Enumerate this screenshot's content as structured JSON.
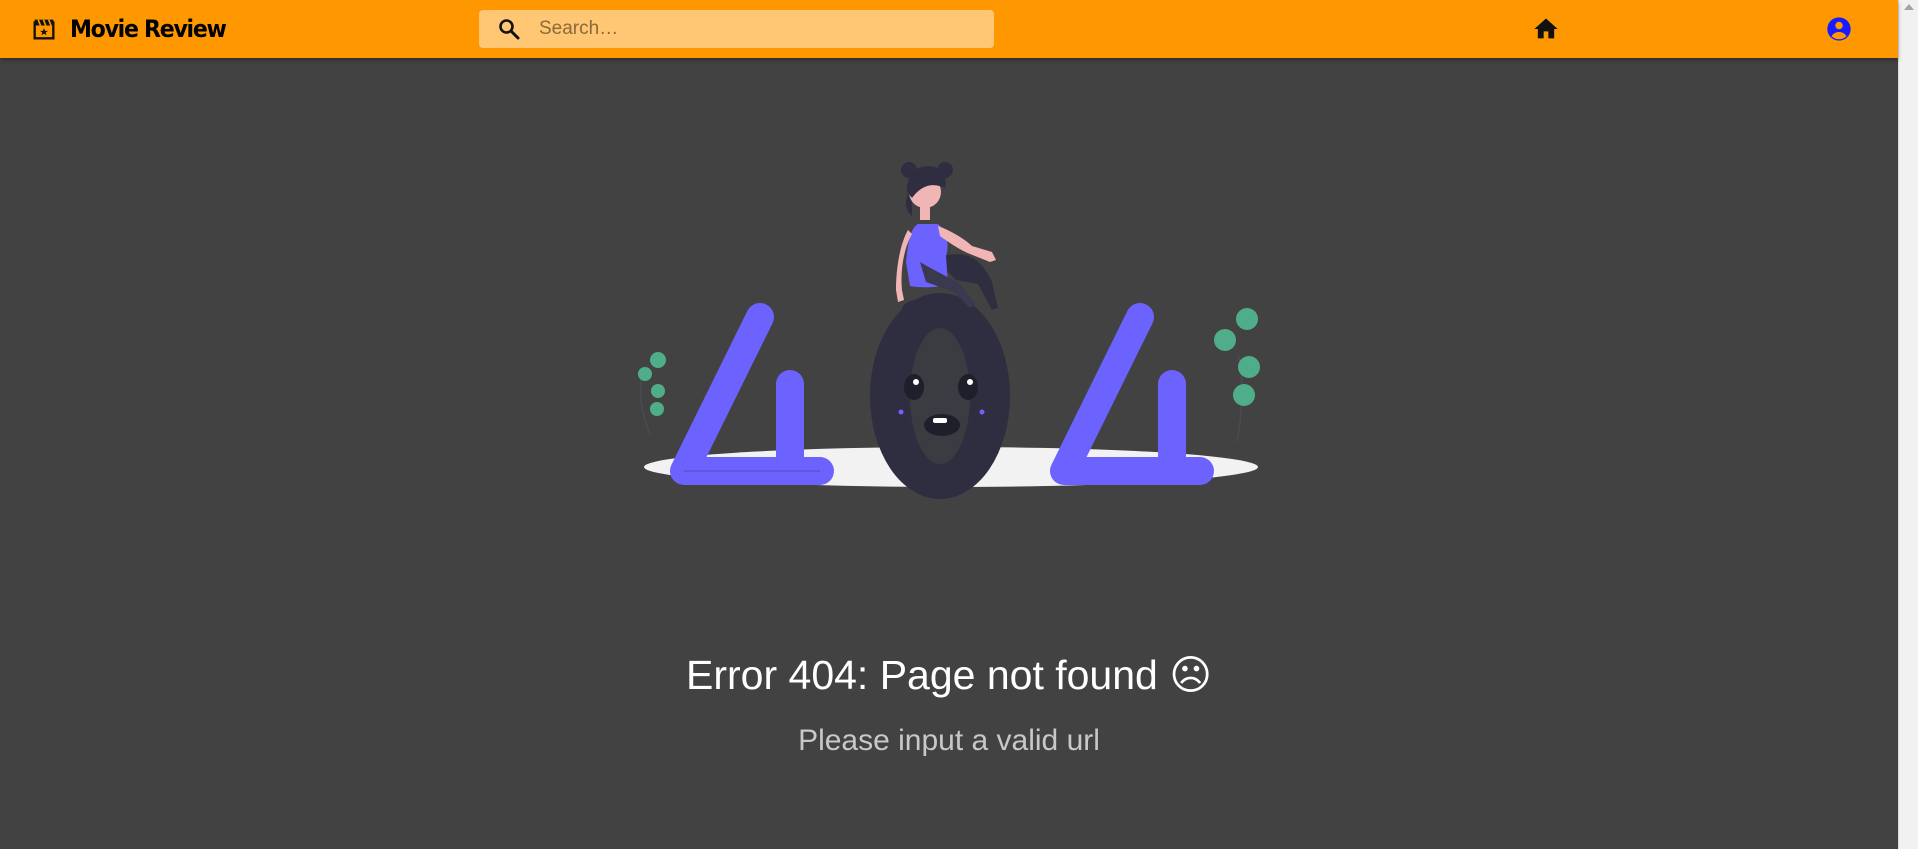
{
  "app": {
    "title": "Movie Review",
    "brand_icon": "movie-clapper-icon",
    "accent_color": "#ff9800"
  },
  "search": {
    "placeholder": "Search…",
    "value": "",
    "icon": "search-icon"
  },
  "nav": {
    "home_icon": "home-icon",
    "account_icon": "account-circle-icon",
    "account_icon_color": "#1a1aff"
  },
  "error": {
    "title": "Error 404: Page not found ☹",
    "subtitle": "Please input a valid url"
  },
  "colors": {
    "page_background": "#424242",
    "digit_4_color": "#6c63ff",
    "digit_0_color": "#2f2e41",
    "plant_color": "#4fad8a"
  }
}
